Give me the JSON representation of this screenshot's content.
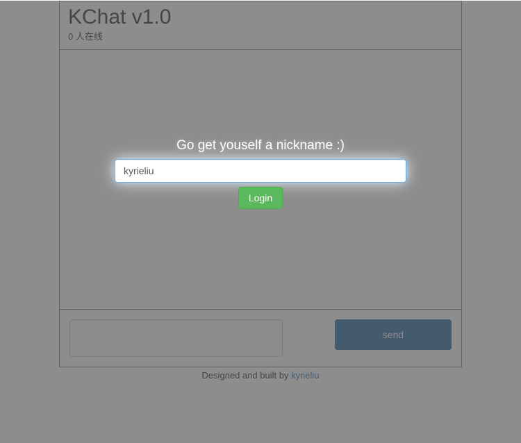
{
  "header": {
    "title": "KChat v1.0",
    "online_count": "0",
    "online_suffix": " 人在线"
  },
  "input": {
    "message_value": "",
    "send_label": "send"
  },
  "footer": {
    "text": "Designed and built by ",
    "link_label": "kyrieliu"
  },
  "modal": {
    "title": "Go get youself a nickname :)",
    "nickname_value": "kyrieliu",
    "login_label": "Login"
  }
}
